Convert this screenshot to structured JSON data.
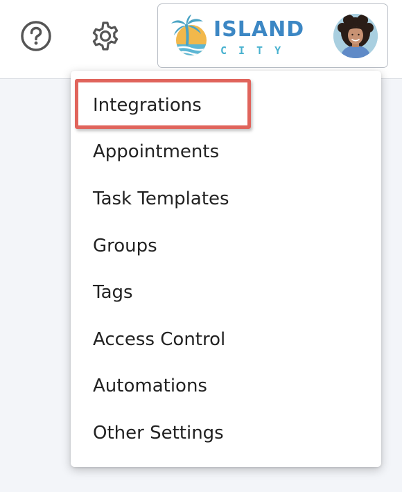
{
  "header": {
    "help_icon": "question-circle-icon",
    "settings_icon": "gear-icon",
    "brand": {
      "word1": "ISLAND",
      "word2": "CITY",
      "colors": {
        "primary": "#3c87c4",
        "secondary": "#47b1cf",
        "sun": "#f2b84b",
        "palm": "#4aa3c4",
        "water": "#5cb6d4"
      }
    },
    "avatar_icon": "user-avatar"
  },
  "menu": {
    "items": [
      {
        "label": "Integrations",
        "highlighted": true
      },
      {
        "label": "Appointments"
      },
      {
        "label": "Task Templates"
      },
      {
        "label": "Groups"
      },
      {
        "label": "Tags"
      },
      {
        "label": "Access Control"
      },
      {
        "label": "Automations"
      },
      {
        "label": "Other Settings"
      }
    ],
    "highlight_color": "#e0645c"
  }
}
